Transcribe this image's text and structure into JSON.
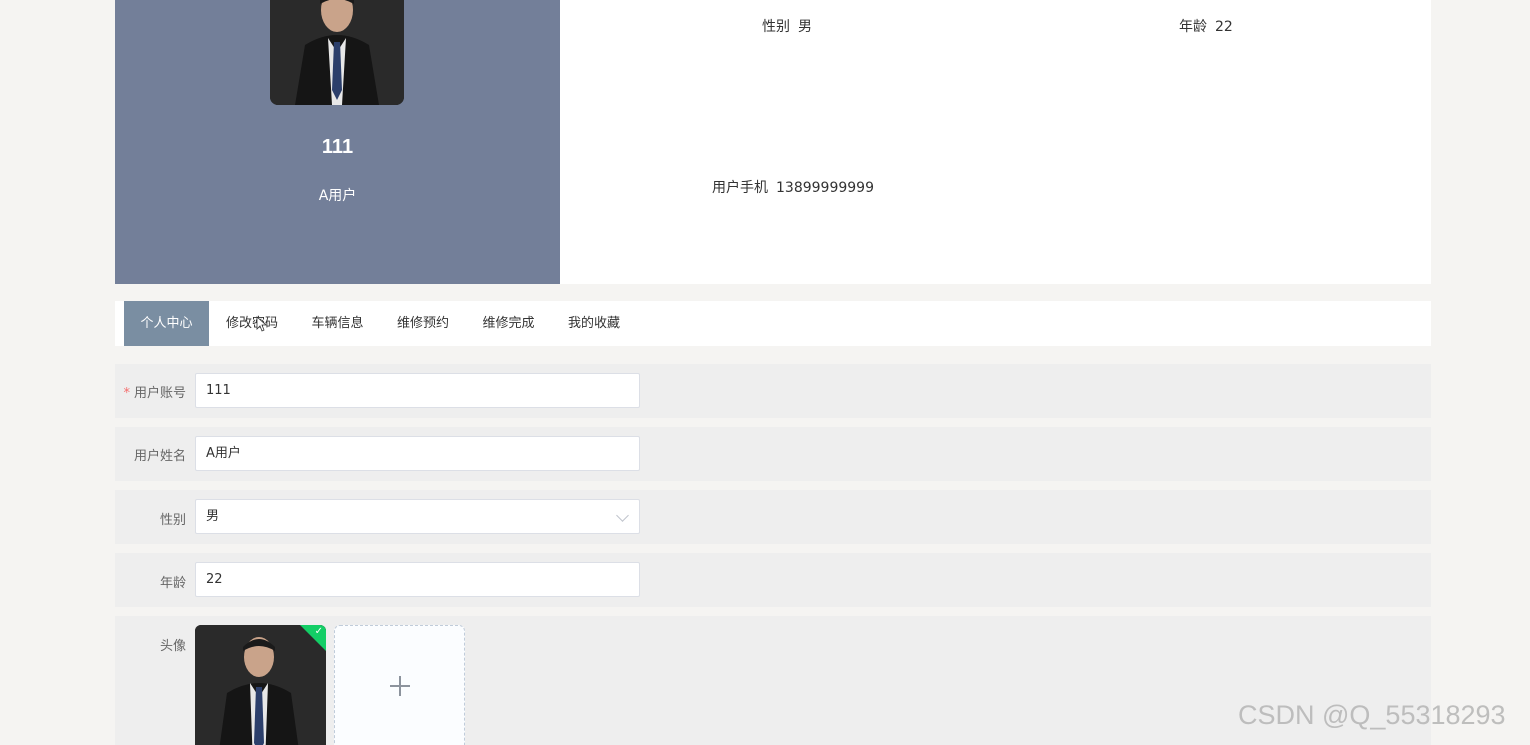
{
  "profile": {
    "username": "111",
    "role": "A用户",
    "gender_label": "性别",
    "gender_value": "男",
    "age_label": "年龄",
    "age_value": "22",
    "phone_label": "用户手机",
    "phone_value": "13899999999"
  },
  "tabs": [
    {
      "label": "个人中心",
      "active": true
    },
    {
      "label": "修改密码",
      "active": false
    },
    {
      "label": "车辆信息",
      "active": false
    },
    {
      "label": "维修预约",
      "active": false
    },
    {
      "label": "维修完成",
      "active": false
    },
    {
      "label": "我的收藏",
      "active": false
    }
  ],
  "form": {
    "account_label": "用户账号",
    "account_required_mark": "*",
    "account_value": "111",
    "name_label": "用户姓名",
    "name_value": "A用户",
    "gender_label": "性别",
    "gender_value": "男",
    "age_label": "年龄",
    "age_value": "22",
    "avatar_label": "头像"
  },
  "colors": {
    "profile_panel": "#737f99",
    "active_tab": "#7a8ea2",
    "upload_success": "#13ce66",
    "required": "#f56c6c"
  },
  "icons": {
    "select": "chevron-down-icon",
    "uploaded": "check-icon",
    "add": "plus-icon"
  },
  "watermark": "CSDN @Q_55318293"
}
